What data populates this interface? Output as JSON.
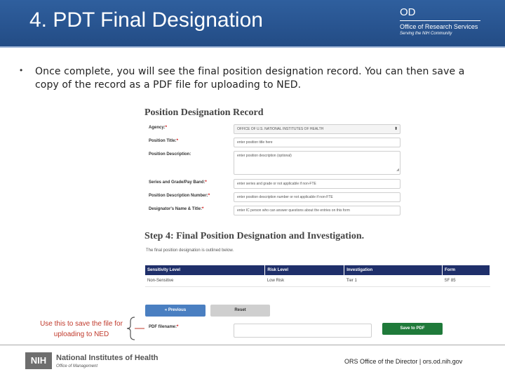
{
  "slide": {
    "title": "4. PDT Final Designation",
    "logo": {
      "od": "OD",
      "office": "Office of Research Services",
      "tagline": "Serving the NIH Community"
    },
    "bullet": "Once complete, you will see the final position designation record. You can then save a copy of the record as a PDF file for uploading to NED.",
    "callout": "Use this to save the file for uploading to NED",
    "footer": {
      "nih_box": "NIH",
      "nih_name": "National Institutes of Health",
      "nih_office": "Office of Management",
      "right_text": "ORS Office of the Director | ors.od.nih.gov"
    }
  },
  "form": {
    "title": "Position Designation Record",
    "rows": [
      {
        "label": "Agency:",
        "req": "*",
        "value": "OFFICE OF U.S. NATIONAL INSTITUTES OF HEALTH",
        "type": "select"
      },
      {
        "label": "Position Title:",
        "req": "*",
        "value": "enter position title here",
        "type": "input"
      },
      {
        "label": "Position Description:",
        "req": "",
        "value": "enter position description (optional)",
        "type": "textarea"
      },
      {
        "label": "Series and Grade/Pay Band:",
        "req": "*",
        "value": "enter series and grade or not applicable if non-FTE",
        "type": "input"
      },
      {
        "label": "Position Description Number:",
        "req": "*",
        "value": "enter position description number or not applicable if non-FTE",
        "type": "input"
      },
      {
        "label": "Designator's Name & Title:",
        "req": "*",
        "value": "enter IC person who can answer questions about the entries on this form",
        "type": "input"
      }
    ],
    "step_title": "Step 4: Final Position Designation and Investigation.",
    "step_sub": "The final position designation is outlined below.",
    "table": {
      "headers": [
        "Sensitivity Level",
        "Risk Level",
        "Investigation",
        "Form"
      ],
      "row": [
        "Non-Sensitive",
        "Low Risk",
        "Tier 1",
        "SF 85"
      ]
    },
    "buttons": {
      "previous": "« Previous",
      "reset": "Reset",
      "save_pdf": "Save to PDF"
    },
    "pdf_label": "PDF filename:",
    "pdf_req": "*"
  }
}
